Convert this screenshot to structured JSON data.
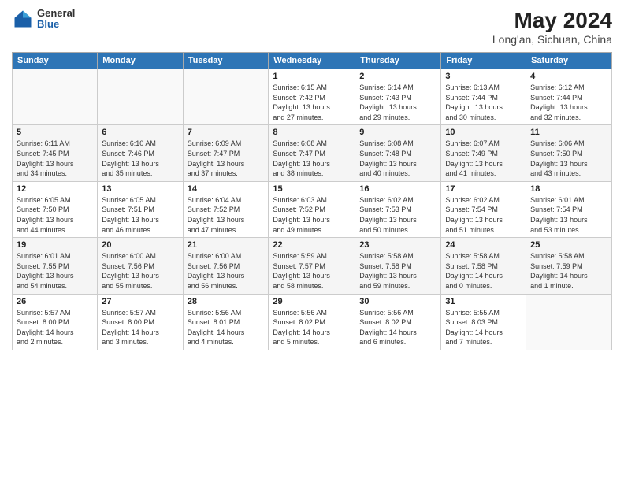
{
  "header": {
    "logo_general": "General",
    "logo_blue": "Blue",
    "title": "May 2024",
    "subtitle": "Long'an, Sichuan, China"
  },
  "weekdays": [
    "Sunday",
    "Monday",
    "Tuesday",
    "Wednesday",
    "Thursday",
    "Friday",
    "Saturday"
  ],
  "weeks": [
    {
      "days": [
        {
          "num": "",
          "info": ""
        },
        {
          "num": "",
          "info": ""
        },
        {
          "num": "",
          "info": ""
        },
        {
          "num": "1",
          "info": "Sunrise: 6:15 AM\nSunset: 7:42 PM\nDaylight: 13 hours\nand 27 minutes."
        },
        {
          "num": "2",
          "info": "Sunrise: 6:14 AM\nSunset: 7:43 PM\nDaylight: 13 hours\nand 29 minutes."
        },
        {
          "num": "3",
          "info": "Sunrise: 6:13 AM\nSunset: 7:44 PM\nDaylight: 13 hours\nand 30 minutes."
        },
        {
          "num": "4",
          "info": "Sunrise: 6:12 AM\nSunset: 7:44 PM\nDaylight: 13 hours\nand 32 minutes."
        }
      ]
    },
    {
      "days": [
        {
          "num": "5",
          "info": "Sunrise: 6:11 AM\nSunset: 7:45 PM\nDaylight: 13 hours\nand 34 minutes."
        },
        {
          "num": "6",
          "info": "Sunrise: 6:10 AM\nSunset: 7:46 PM\nDaylight: 13 hours\nand 35 minutes."
        },
        {
          "num": "7",
          "info": "Sunrise: 6:09 AM\nSunset: 7:47 PM\nDaylight: 13 hours\nand 37 minutes."
        },
        {
          "num": "8",
          "info": "Sunrise: 6:08 AM\nSunset: 7:47 PM\nDaylight: 13 hours\nand 38 minutes."
        },
        {
          "num": "9",
          "info": "Sunrise: 6:08 AM\nSunset: 7:48 PM\nDaylight: 13 hours\nand 40 minutes."
        },
        {
          "num": "10",
          "info": "Sunrise: 6:07 AM\nSunset: 7:49 PM\nDaylight: 13 hours\nand 41 minutes."
        },
        {
          "num": "11",
          "info": "Sunrise: 6:06 AM\nSunset: 7:50 PM\nDaylight: 13 hours\nand 43 minutes."
        }
      ]
    },
    {
      "days": [
        {
          "num": "12",
          "info": "Sunrise: 6:05 AM\nSunset: 7:50 PM\nDaylight: 13 hours\nand 44 minutes."
        },
        {
          "num": "13",
          "info": "Sunrise: 6:05 AM\nSunset: 7:51 PM\nDaylight: 13 hours\nand 46 minutes."
        },
        {
          "num": "14",
          "info": "Sunrise: 6:04 AM\nSunset: 7:52 PM\nDaylight: 13 hours\nand 47 minutes."
        },
        {
          "num": "15",
          "info": "Sunrise: 6:03 AM\nSunset: 7:52 PM\nDaylight: 13 hours\nand 49 minutes."
        },
        {
          "num": "16",
          "info": "Sunrise: 6:02 AM\nSunset: 7:53 PM\nDaylight: 13 hours\nand 50 minutes."
        },
        {
          "num": "17",
          "info": "Sunrise: 6:02 AM\nSunset: 7:54 PM\nDaylight: 13 hours\nand 51 minutes."
        },
        {
          "num": "18",
          "info": "Sunrise: 6:01 AM\nSunset: 7:54 PM\nDaylight: 13 hours\nand 53 minutes."
        }
      ]
    },
    {
      "days": [
        {
          "num": "19",
          "info": "Sunrise: 6:01 AM\nSunset: 7:55 PM\nDaylight: 13 hours\nand 54 minutes."
        },
        {
          "num": "20",
          "info": "Sunrise: 6:00 AM\nSunset: 7:56 PM\nDaylight: 13 hours\nand 55 minutes."
        },
        {
          "num": "21",
          "info": "Sunrise: 6:00 AM\nSunset: 7:56 PM\nDaylight: 13 hours\nand 56 minutes."
        },
        {
          "num": "22",
          "info": "Sunrise: 5:59 AM\nSunset: 7:57 PM\nDaylight: 13 hours\nand 58 minutes."
        },
        {
          "num": "23",
          "info": "Sunrise: 5:58 AM\nSunset: 7:58 PM\nDaylight: 13 hours\nand 59 minutes."
        },
        {
          "num": "24",
          "info": "Sunrise: 5:58 AM\nSunset: 7:58 PM\nDaylight: 14 hours\nand 0 minutes."
        },
        {
          "num": "25",
          "info": "Sunrise: 5:58 AM\nSunset: 7:59 PM\nDaylight: 14 hours\nand 1 minute."
        }
      ]
    },
    {
      "days": [
        {
          "num": "26",
          "info": "Sunrise: 5:57 AM\nSunset: 8:00 PM\nDaylight: 14 hours\nand 2 minutes."
        },
        {
          "num": "27",
          "info": "Sunrise: 5:57 AM\nSunset: 8:00 PM\nDaylight: 14 hours\nand 3 minutes."
        },
        {
          "num": "28",
          "info": "Sunrise: 5:56 AM\nSunset: 8:01 PM\nDaylight: 14 hours\nand 4 minutes."
        },
        {
          "num": "29",
          "info": "Sunrise: 5:56 AM\nSunset: 8:02 PM\nDaylight: 14 hours\nand 5 minutes."
        },
        {
          "num": "30",
          "info": "Sunrise: 5:56 AM\nSunset: 8:02 PM\nDaylight: 14 hours\nand 6 minutes."
        },
        {
          "num": "31",
          "info": "Sunrise: 5:55 AM\nSunset: 8:03 PM\nDaylight: 14 hours\nand 7 minutes."
        },
        {
          "num": "",
          "info": ""
        }
      ]
    }
  ]
}
